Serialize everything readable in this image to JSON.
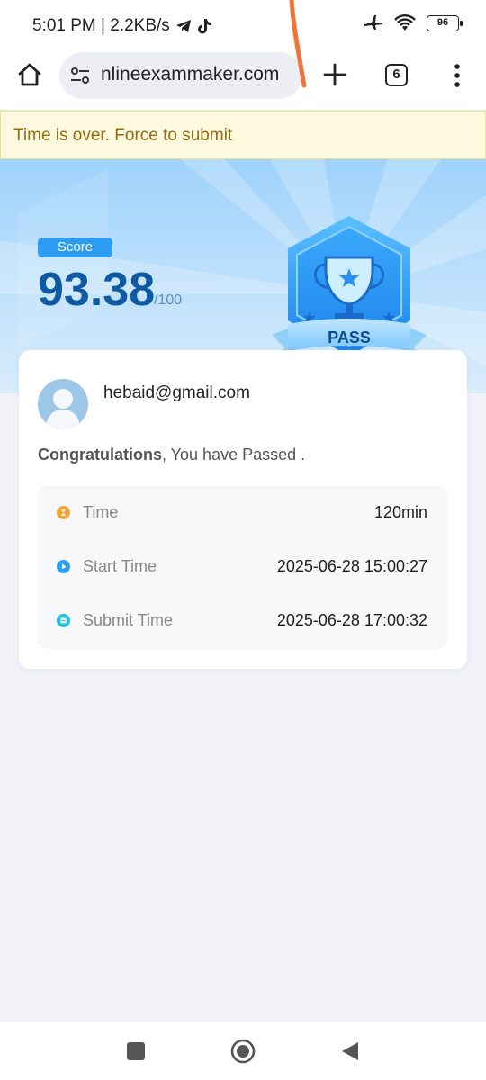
{
  "status_bar": {
    "time_speed": "5:01 PM | 2.2KB/s",
    "battery": "96"
  },
  "browser": {
    "url": "nlineexammaker.com",
    "tab_count": "6"
  },
  "banner": {
    "message": "Time is over. Force to submit"
  },
  "result": {
    "score_label": "Score",
    "score": "93.38",
    "score_max": "/100",
    "badge_text": "PASS"
  },
  "user": {
    "email": "hebaid@gmail.com",
    "congrats_bold": "Congratulations",
    "congrats_rest": ", You have Passed ."
  },
  "details": [
    {
      "label": "Time",
      "value": "120min",
      "icon": "hourglass-icon",
      "color": "#f5a334"
    },
    {
      "label": "Start Time",
      "value": "2025-06-28 15:00:27",
      "icon": "play-icon",
      "color": "#2f9ef0"
    },
    {
      "label": "Submit Time",
      "value": "2025-06-28 17:00:32",
      "icon": "submit-icon",
      "color": "#27c0d8"
    }
  ],
  "colors": {
    "accent": "#2d9df2",
    "score": "#0f5aa4",
    "banner_text": "#9a6a10"
  }
}
